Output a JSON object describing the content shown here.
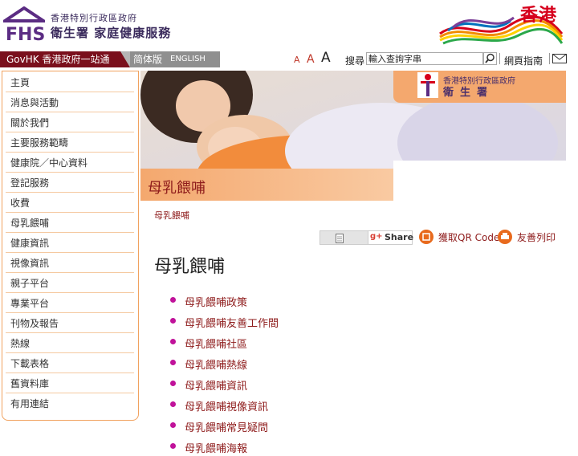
{
  "header": {
    "org_line1": "香港特別行政區政府",
    "org_line2": "衛生署 家庭健康服務",
    "brand_text": "香港"
  },
  "navbar": {
    "govhk": "GovHK 香港政府一站通",
    "lang_sc": "简体版",
    "lang_en": "ENGLISH",
    "font_small": "A",
    "font_medium": "A",
    "font_large": "A",
    "search_label": "搜尋",
    "search_value": "輸入查詢字串",
    "sitemap": "網頁指南"
  },
  "sidebar": {
    "items": [
      {
        "label": "主頁"
      },
      {
        "label": "消息與活動"
      },
      {
        "label": "關於我們"
      },
      {
        "label": "主要服務範疇"
      },
      {
        "label": "健康院／中心資料"
      },
      {
        "label": "登記服務"
      },
      {
        "label": "收費"
      },
      {
        "label": "母乳餵哺"
      },
      {
        "label": "健康資訊"
      },
      {
        "label": "視像資訊"
      },
      {
        "label": "親子平台"
      },
      {
        "label": "專業平台"
      },
      {
        "label": "刊物及報告"
      },
      {
        "label": "熱線"
      },
      {
        "label": "下載表格"
      },
      {
        "label": "舊資料庫"
      },
      {
        "label": "有用連結"
      }
    ]
  },
  "banner": {
    "title": "母乳餵哺",
    "dept_line1": "香港特別行政區政府",
    "dept_line2": "衛生署"
  },
  "breadcrumb": "母乳餵哺",
  "share": {
    "gplus_icon": "g+",
    "gplus_label": "Share",
    "qr_label": "獲取QR Code",
    "print_label": "友善列印"
  },
  "page_title": "母乳餵哺",
  "content_links": [
    {
      "label": "母乳餵哺政策"
    },
    {
      "label": "母乳餵哺友善工作間"
    },
    {
      "label": "母乳餵哺社區"
    },
    {
      "label": "母乳餵哺熱線"
    },
    {
      "label": "母乳餵哺資訊"
    },
    {
      "label": "母乳餵哺視像資訊"
    },
    {
      "label": "母乳餵哺常見疑問"
    },
    {
      "label": "母乳餵哺海報"
    }
  ],
  "colors": {
    "accent": "#8e1b1b",
    "sidebar_border": "#f1a25f",
    "bullet": "#c0129a",
    "govhk_bar": "#7a0f1c"
  }
}
